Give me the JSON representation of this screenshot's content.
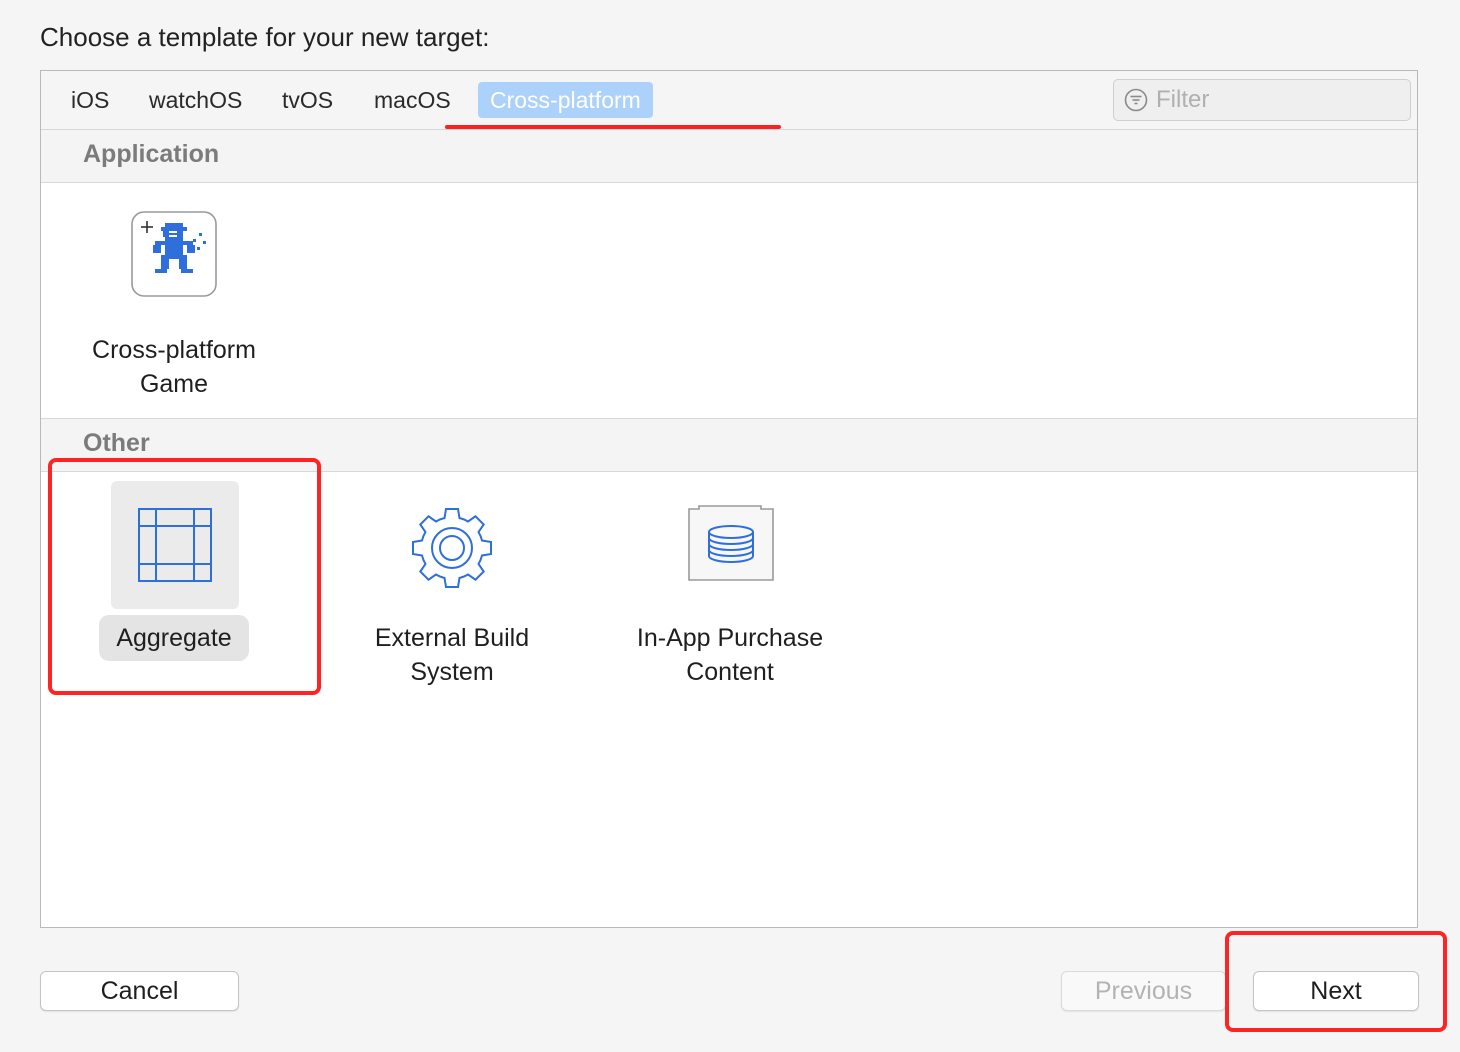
{
  "heading": "Choose a template for your new target:",
  "tabs": [
    {
      "label": "iOS"
    },
    {
      "label": "watchOS"
    },
    {
      "label": "tvOS"
    },
    {
      "label": "macOS"
    },
    {
      "label": "Cross-platform",
      "selected": true
    }
  ],
  "filter": {
    "placeholder": "Filter",
    "value": ""
  },
  "sections": [
    {
      "title": "Application",
      "templates": [
        {
          "label": "Cross-platform Game",
          "icon": "game-sprite-icon"
        }
      ]
    },
    {
      "title": "Other",
      "templates": [
        {
          "label": "Aggregate",
          "icon": "aggregate-icon",
          "selected": true
        },
        {
          "label": "External Build System",
          "icon": "gear-icon"
        },
        {
          "label": "In-App Purchase Content",
          "icon": "database-icon"
        }
      ]
    }
  ],
  "buttons": {
    "cancel": "Cancel",
    "previous": "Previous",
    "next": "Next"
  },
  "colors": {
    "accent": "#acd1fb",
    "icon_blue": "#2f6fdc",
    "annotation_red": "#ff2424"
  }
}
